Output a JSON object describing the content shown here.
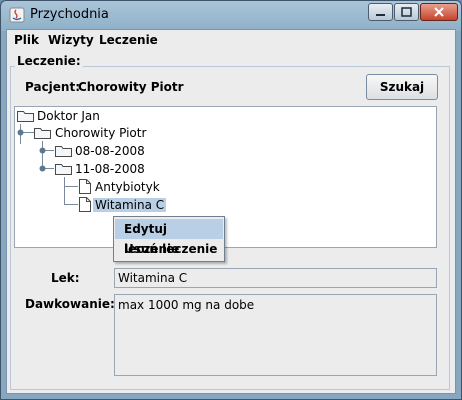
{
  "window": {
    "title": "Przychodnia",
    "colors": {
      "selection": "#b8cfe5",
      "close_button": "#c7432d",
      "frame": "#86a7bf"
    }
  },
  "menubar": {
    "items": [
      "Plik",
      "Wizyty",
      "Leczenie"
    ]
  },
  "panel": {
    "group_title": "Leczenie:",
    "patient_label": "Pacjent:",
    "patient_name": "Chorowity Piotr",
    "search_button": "Szukaj"
  },
  "tree": {
    "nodes": [
      {
        "label": "Doktor Jan",
        "icon": "folder-icon"
      },
      {
        "label": "Chorowity Piotr",
        "icon": "folder-icon"
      },
      {
        "label": "08-08-2008",
        "icon": "folder-icon"
      },
      {
        "label": "11-08-2008",
        "icon": "folder-icon"
      },
      {
        "label": "Antybiotyk",
        "icon": "document-icon"
      },
      {
        "label": "Witamina C",
        "icon": "document-icon",
        "selected": true
      }
    ]
  },
  "context_menu": {
    "items": [
      "Edytuj leczenie",
      "Usuń leczenie"
    ],
    "highlighted": "Edytuj leczenie"
  },
  "form": {
    "drug_label": "Lek:",
    "drug_value": "Witamina C",
    "dosage_label": "Dawkowanie:",
    "dosage_value": "max 1000 mg na dobe"
  }
}
